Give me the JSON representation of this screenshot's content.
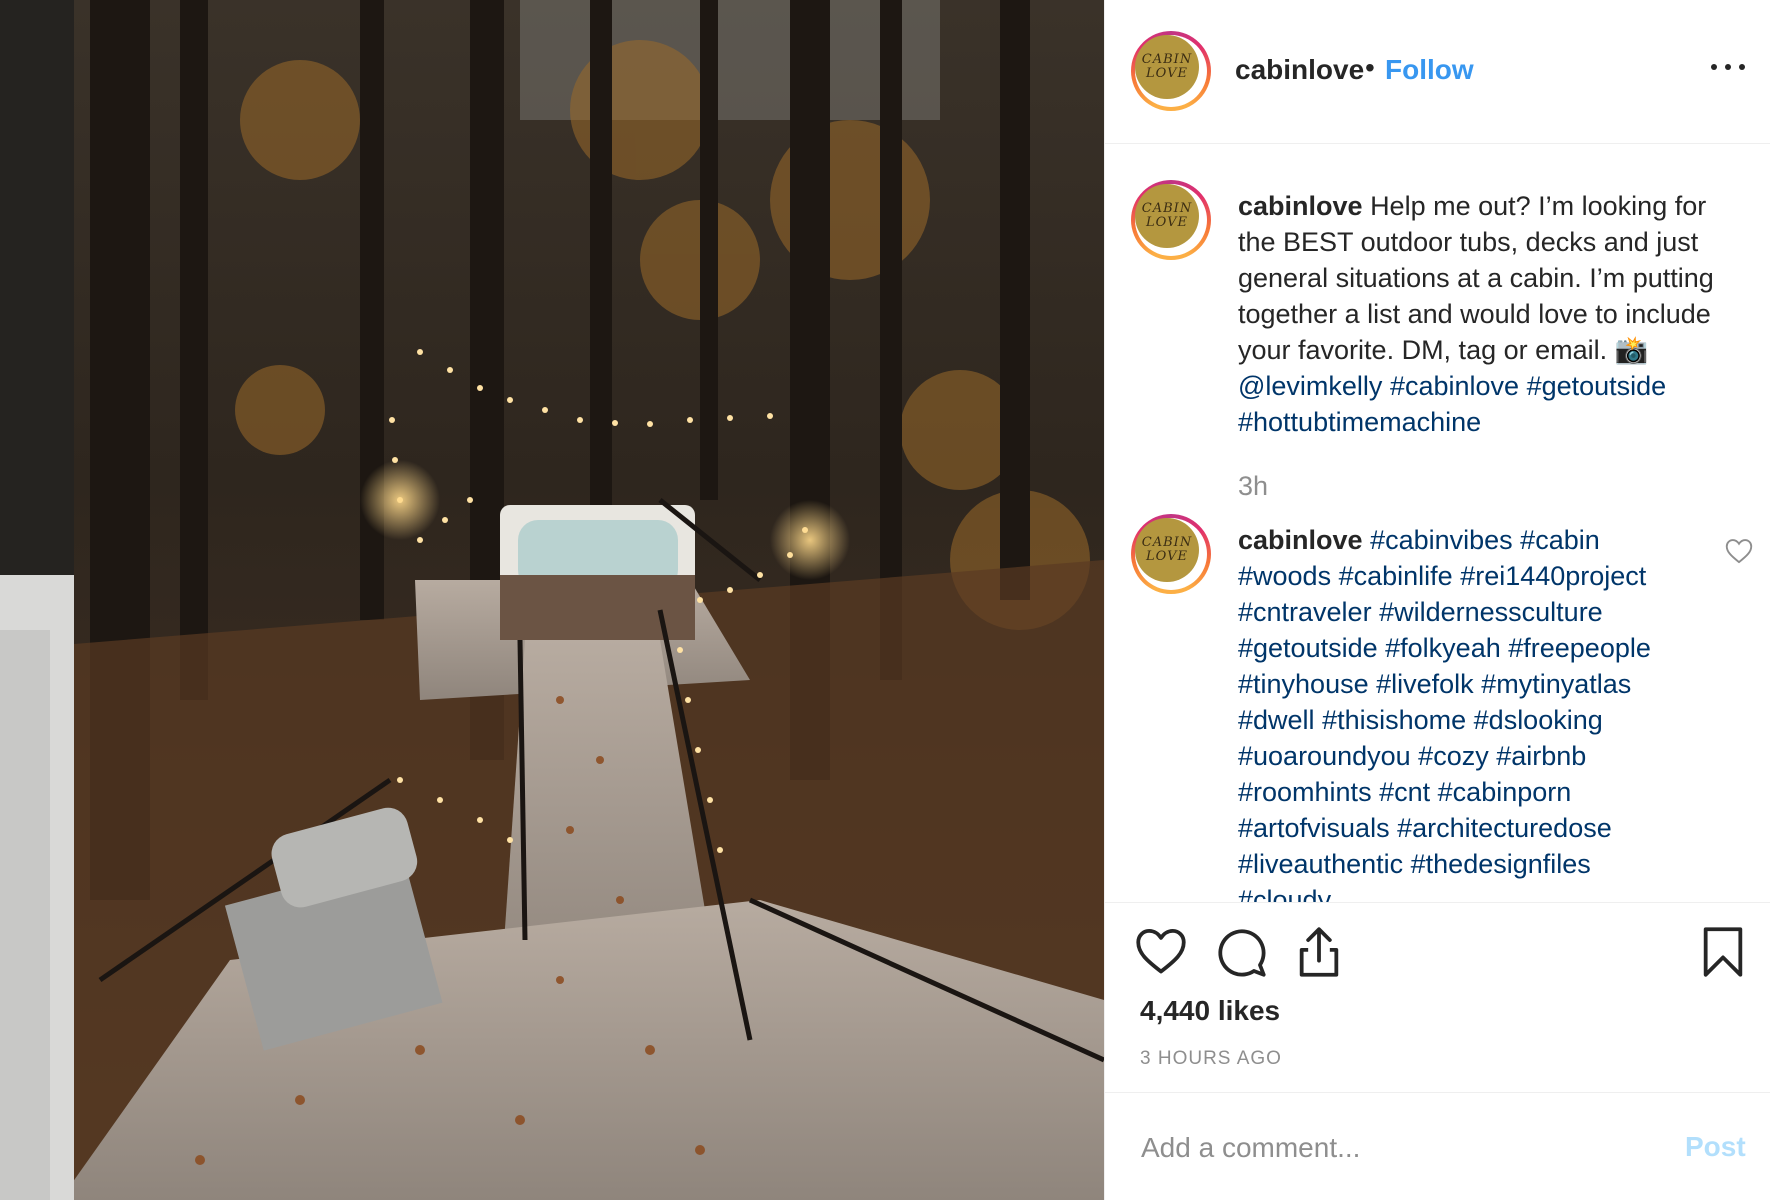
{
  "post": {
    "image_description": "cabin-deck-hot-tub-forest-photo"
  },
  "header": {
    "username": "cabinlove",
    "separator": "•",
    "follow_label": "Follow",
    "more_icon": "more-horizontal-icon",
    "avatar_text_top": "CABIN",
    "avatar_text_bottom": "LOVE"
  },
  "caption": {
    "username": "cabinlove",
    "text": "Help me out? I’m looking for the BEST outdoor tubs, decks and just general situations at a cabin. I’m putting together a list and would love to include your favorite. DM, tag or email. 📸",
    "mention": "@levimkelly",
    "tags": [
      "#cabinlove",
      "#getoutside",
      "#hottubtimemachine"
    ],
    "time": "3h"
  },
  "comment": {
    "username": "cabinlove",
    "tags": [
      "#cabinvibes",
      "#cabin",
      "#woods",
      "#cabinlife",
      "#rei1440project",
      "#cntraveler",
      "#wildernessculture",
      "#getoutside",
      "#folkyeah",
      "#freepeople",
      "#tinyhouse",
      "#livefolk",
      "#mytinyatlas",
      "#dwell",
      "#thisishome",
      "#dslooking",
      "#uoaroundyou",
      "#cozy",
      "#airbnb",
      "#roomhints",
      "#cnt",
      "#cabinporn",
      "#artofvisuals",
      "#architecturedose",
      "#liveauthentic",
      "#thedesignfiles",
      "#cloudy"
    ]
  },
  "actions": {
    "likes": "4,440 likes",
    "posted": "3 HOURS AGO",
    "icons": [
      "heart-icon",
      "comment-icon",
      "share-icon",
      "bookmark-icon"
    ]
  },
  "add_comment": {
    "placeholder": "Add a comment...",
    "post_label": "Post"
  },
  "colors": {
    "link": "#3897f0",
    "hashtag": "#003569",
    "muted": "#8e8e8e",
    "post_disabled": "#b2dffc"
  }
}
